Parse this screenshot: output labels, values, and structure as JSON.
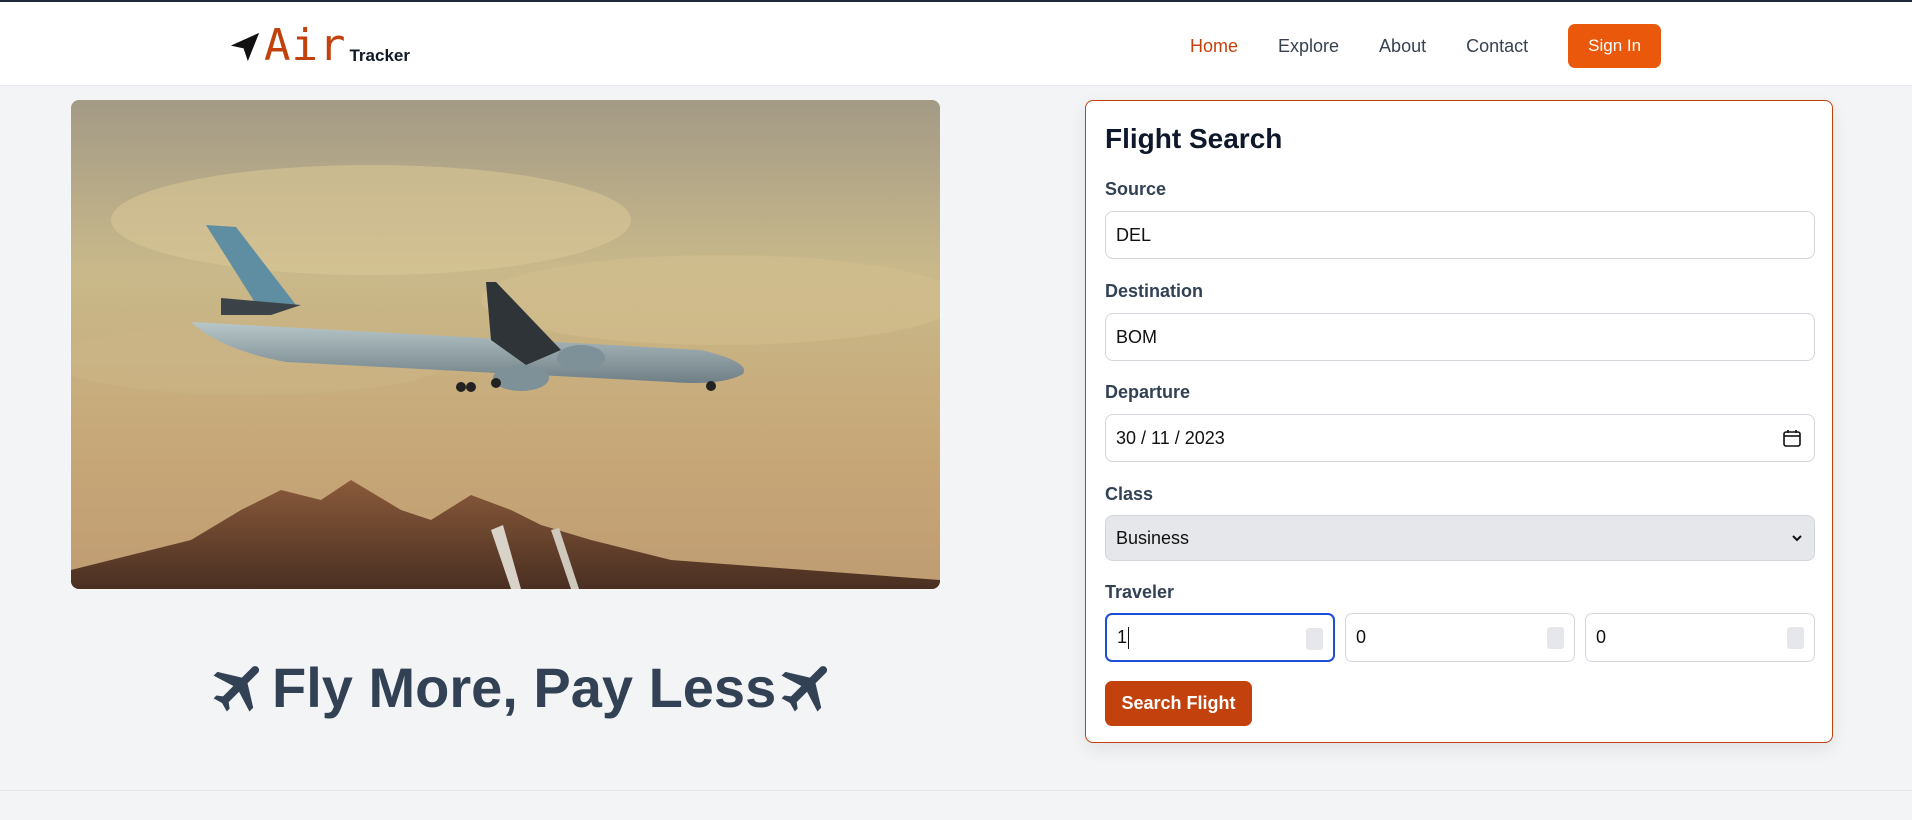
{
  "brand": {
    "air": "Air",
    "tracker": "Tracker",
    "icon": "paper-plane-icon"
  },
  "nav": {
    "links": [
      {
        "label": "Home",
        "active": true
      },
      {
        "label": "Explore",
        "active": false
      },
      {
        "label": "About",
        "active": false
      },
      {
        "label": "Contact",
        "active": false
      }
    ],
    "signin_label": "Sign In"
  },
  "hero": {
    "image": "airplane-over-mountains"
  },
  "slogan": {
    "text": "Fly More, Pay Less",
    "icon": "airplane-icon"
  },
  "search": {
    "title": "Flight Search",
    "source": {
      "label": "Source",
      "value": "DEL"
    },
    "destination": {
      "label": "Destination",
      "value": "BOM"
    },
    "departure": {
      "label": "Departure",
      "value": "30 / 11 / 2023",
      "icon": "calendar-icon"
    },
    "class": {
      "label": "Class",
      "value": "Business"
    },
    "traveler": {
      "label": "Traveler",
      "values": [
        "1",
        "0",
        "0"
      ]
    },
    "submit_label": "Search Flight"
  },
  "colors": {
    "accent": "#c2410c",
    "button": "#ea580c",
    "focus": "#1d4ed8",
    "bg": "#f3f4f6"
  }
}
